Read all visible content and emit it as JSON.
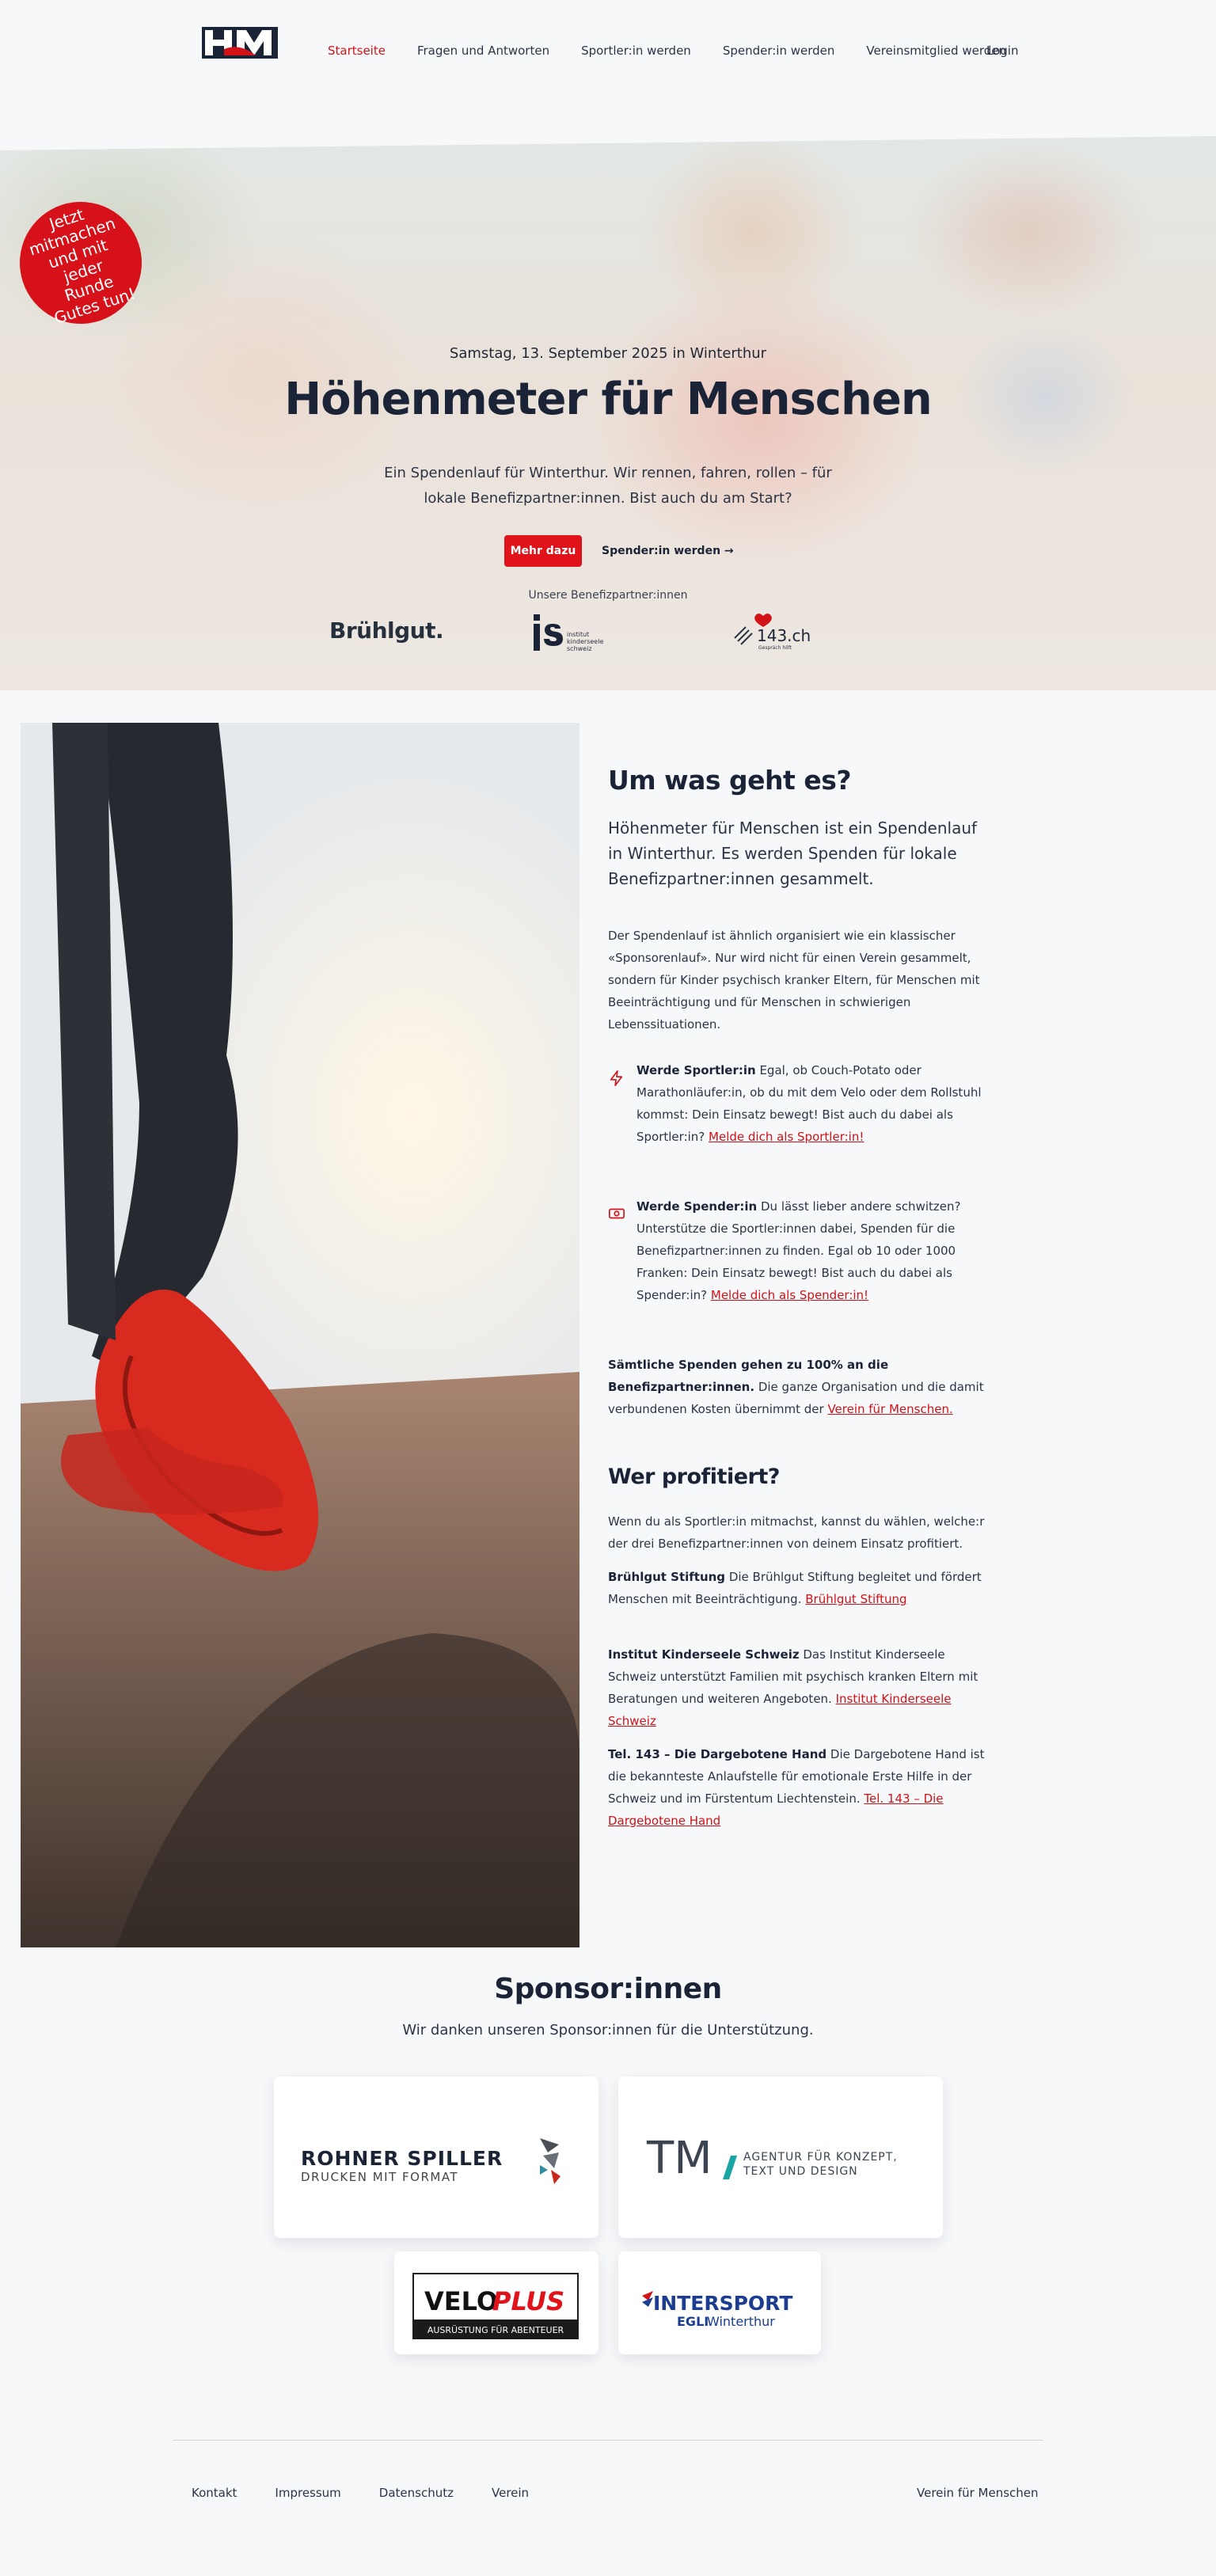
{
  "nav": {
    "logo_alt": "HfM",
    "items": [
      {
        "label": "Startseite",
        "active": true
      },
      {
        "label": "Fragen und Antworten",
        "active": false
      },
      {
        "label": "Sportler:in werden",
        "active": false
      },
      {
        "label": "Spender:in werden",
        "active": false
      },
      {
        "label": "Vereinsmitglied werden",
        "active": false
      }
    ],
    "login": "Login"
  },
  "hero": {
    "badge": "Jetzt mitmachen und mit jeder Runde Gutes tun!",
    "date": "Samstag, 13. September 2025 in Winterthur",
    "title": "Höhenmeter für Menschen",
    "subtitle": "Ein Spendenlauf für Winterthur. Wir rennen, fahren, rollen – für lokale Benefizpartner:innen. Bist auch du am Start?",
    "primary_button": "Mehr dazu",
    "secondary_link": "Spender:in werden →",
    "partners_label": "Unsere Benefizpartner:innen",
    "partners": {
      "bruhlgut": "Brühlgut.",
      "is_line1": "institut",
      "is_line2": "kinderseele",
      "is_line3": "schweiz",
      "tel143": "143.ch",
      "tel143_sub": "Gespräch hilft"
    }
  },
  "about": {
    "heading": "Um was geht es?",
    "lead": "Höhenmeter für Menschen ist ein Spendenlauf in Winterthur. Es werden Spenden für lokale Benefizpartner:innen gesammelt.",
    "intro": "Der Spendenlauf ist ähnlich organisiert wie ein klassischer «Sponsorenlauf». Nur wird nicht für einen Verein gesammelt, sondern für Kinder psychisch kranker Eltern, für Menschen mit Beeinträchtigung und für Menschen in schwierigen Lebenssituationen.",
    "feature1": {
      "title": "Werde Sportler:in",
      "text": " Egal, ob Couch-Potato oder Marathonläufer:in, ob du mit dem Velo oder dem Rollstuhl kommst: Dein Einsatz bewegt! Bist auch du dabei als Sportler:in? ",
      "link": "Melde dich als Sportler:in!"
    },
    "feature2": {
      "title": "Werde Spender:in",
      "text": " Du lässt lieber andere schwitzen? Unterstütze die Sportler:innen dabei, Spenden für die Benefizpartner:innen zu finden. Egal ob 10 oder 1000 Franken: Dein Einsatz bewegt! Bist auch du dabei als Spender:in? ",
      "link": "Melde dich als Spender:in!"
    },
    "donation_bold": "Sämtliche Spenden gehen zu 100% an die Benefizpartner:innen.",
    "donation_text": " Die ganze Organisation und die damit verbundenen Kosten übernimmt der ",
    "donation_link": "Verein für Menschen.",
    "heading2": "Wer profitiert?",
    "profit_intro": "Wenn du als Sportler:in mitmachst, kannst du wählen, welche:r der drei Benefizpartner:innen von deinem Einsatz profitiert.",
    "b1": {
      "title": "Brühlgut Stiftung",
      "text": " Die Brühlgut Stiftung begleitet und fördert Menschen mit Beeinträchtigung. ",
      "link": "Brühlgut Stiftung"
    },
    "b2": {
      "title": "Institut Kinderseele Schweiz",
      "text": " Das Institut Kinderseele Schweiz unterstützt Familien mit psychisch kranken Eltern mit Beratungen und weiteren Angeboten. ",
      "link": "Institut Kinderseele Schweiz"
    },
    "b3": {
      "title": "Tel. 143 – Die Dargebotene Hand",
      "text": " Die Dargebotene Hand ist die bekannteste Anlaufstelle für emotionale Erste Hilfe in der Schweiz und im Fürstentum Liechtenstein. ",
      "link": "Tel. 143 – Die Dargebotene Hand"
    }
  },
  "sponsors": {
    "heading": "Sponsor:innen",
    "subtitle": "Wir danken unseren Sponsor:innen für die Unterstützung.",
    "rohner": {
      "line1": "ROHNER SPILLER",
      "line2": "DRUCKEN MIT FORMAT"
    },
    "tm": {
      "mark": "TM",
      "line1": "AGENTUR FÜR KONZEPT,",
      "line2": "TEXT UND DESIGN"
    },
    "velo": {
      "a": "VELO",
      "b": "PLUS",
      "sub": "AUSRÜSTUNG FÜR ABENTEUER"
    },
    "intersport": {
      "name": "INTERSPORT",
      "sub_a": "EGLI",
      "sub_b": " Winterthur"
    }
  },
  "footer": {
    "links": [
      "Kontakt",
      "Impressum",
      "Datenschutz",
      "Verein"
    ],
    "right": "Verein für Menschen"
  },
  "colors": {
    "accent": "#d31218",
    "navy": "#1b2436",
    "background": "#f7f8fa"
  }
}
